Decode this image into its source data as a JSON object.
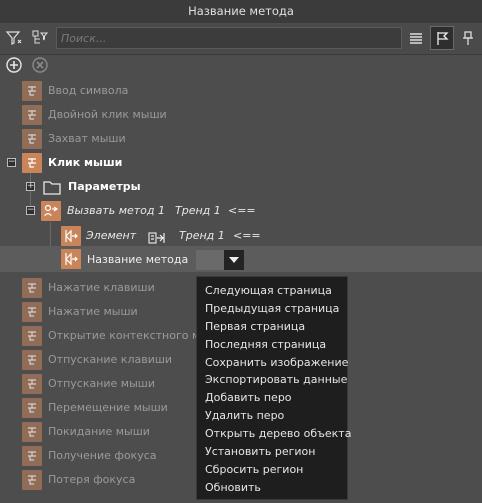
{
  "title": "Название метода",
  "search": {
    "placeholder": "Поиск..."
  },
  "tree": {
    "items_top": [
      "Ввод символа",
      "Двойной клик мыши",
      "Захват мыши"
    ],
    "click_label": "Клик мыши",
    "params_label": "Параметры",
    "call_method": {
      "label": "Вызвать метод 1",
      "trend": "Тренд 1",
      "op": "<=="
    },
    "element_row": {
      "label": "Элемент",
      "trend": "Тренд 1",
      "op": "<=="
    },
    "method_name_row": {
      "label": "Название метода"
    },
    "items_bottom": [
      "Нажатие клавиши",
      "Нажатие мыши",
      "Открытие контекстного ме",
      "Отпускание клавиши",
      "Отпускание мыши",
      "Перемещение мыши",
      "Покидание мыши",
      "Получение фокуса",
      "Потеря фокуса"
    ]
  },
  "dropdown_options": [
    "Следующая страница",
    "Предыдущая страница",
    "Первая страница",
    "Последняя страница",
    "Сохранить изображение",
    "Экспортировать данные",
    "Добавить перо",
    "Удалить перо",
    "Открыть дерево объекта",
    "Установить регион",
    "Сбросить регион",
    "Обновить"
  ],
  "colors": {
    "event_icon": "#c9845a",
    "background": "#4d4d4d",
    "dropdown_bg": "#1e1e1e"
  }
}
